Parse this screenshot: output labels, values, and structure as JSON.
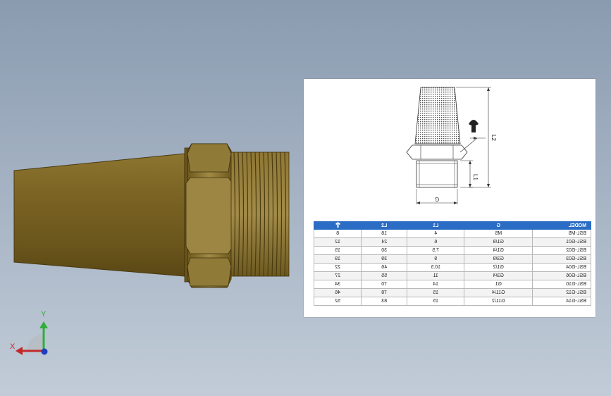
{
  "viewport": {
    "background_top": "#8a9bb0",
    "background_bottom": "#c2ccd8",
    "part_color": "#7a6323",
    "part_highlight": "#9a8240"
  },
  "triad": {
    "x_label": "X",
    "y_label": "Y",
    "x_color": "#c12a2a",
    "y_color": "#2fae3a",
    "z_color": "#1f3fb8"
  },
  "drawing": {
    "label_G": "G",
    "label_L1": "L1",
    "label_L2": "L2",
    "wrench_icon": "wrench-icon"
  },
  "table": {
    "header_color": "#2b6cc4",
    "headers": [
      "MODEL",
      "G",
      "L1",
      "L2",
      "wrench"
    ],
    "wrench_header_icon": "wrench-icon",
    "rows": [
      {
        "model": "BSL-M5",
        "g": "M5",
        "l1": "4",
        "l2": "18",
        "w": "8"
      },
      {
        "model": "BSL-G01",
        "g": "G1/8",
        "l1": "6",
        "l2": "24",
        "w": "12"
      },
      {
        "model": "BSL-G02",
        "g": "G1/4",
        "l1": "7.5",
        "l2": "30",
        "w": "15"
      },
      {
        "model": "BSL-G03",
        "g": "G3/8",
        "l1": "9",
        "l2": "39",
        "w": "19"
      },
      {
        "model": "BSL-G04",
        "g": "G1/2",
        "l1": "10.5",
        "l2": "46",
        "w": "22"
      },
      {
        "model": "BSL-G06",
        "g": "G3/4",
        "l1": "11",
        "l2": "55",
        "w": "27"
      },
      {
        "model": "BSL-G10",
        "g": "G1",
        "l1": "14",
        "l2": "70",
        "w": "34"
      },
      {
        "model": "BSL-G12",
        "g": "G11/4",
        "l1": "15",
        "l2": "78",
        "w": "46"
      },
      {
        "model": "BSL-G14",
        "g": "G11/2",
        "l1": "15",
        "l2": "83",
        "w": "52"
      }
    ]
  }
}
